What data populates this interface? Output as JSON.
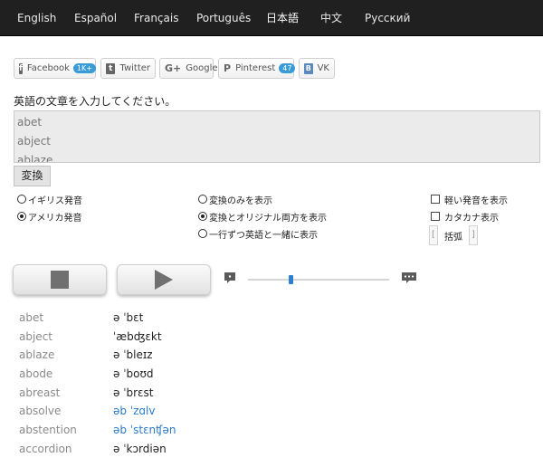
{
  "nav": {
    "languages": [
      {
        "label": "English",
        "active": false
      },
      {
        "label": "Español",
        "active": false
      },
      {
        "label": "Français",
        "active": false
      },
      {
        "label": "Português",
        "active": false
      },
      {
        "label": "日本語",
        "active": true
      },
      {
        "label": "中文",
        "active": false
      },
      {
        "label": "Русский",
        "active": false
      }
    ]
  },
  "share": {
    "facebook": {
      "label": "Facebook",
      "count": "1K+"
    },
    "twitter": {
      "label": "Twitter"
    },
    "google": {
      "label": "Google"
    },
    "pinterest": {
      "label": "Pinterest",
      "count": "47"
    },
    "vk": {
      "label": "VK"
    }
  },
  "input": {
    "prompt": "英語の文章を入力してください。",
    "lines": [
      "abet",
      "abject",
      "ablaze"
    ],
    "convert_label": "変換"
  },
  "options": {
    "british": {
      "label": "イギリス発音",
      "selected": false
    },
    "american": {
      "label": "アメリカ発音",
      "selected": true
    },
    "convert_only": {
      "label": "変換のみを表示",
      "selected": false
    },
    "convert_and_original": {
      "label": "変換とオリジナル両方を表示",
      "selected": true
    },
    "line_by_line": {
      "label": "一行ずつ英語と一緒に表示",
      "selected": false
    },
    "weak_forms": {
      "label": "軽い発音を表示",
      "checked": false
    },
    "katakana": {
      "label": "カタカナ表示",
      "checked": false
    },
    "brackets_label": "括弧",
    "bracket_left": "[",
    "bracket_right": "]"
  },
  "player": {
    "speed_fraction": 0.3
  },
  "results": [
    {
      "word": "abet",
      "ipa": "ə ˈbɛt",
      "highlight": false
    },
    {
      "word": "abject",
      "ipa": "ˈæbʤɛkt",
      "highlight": false
    },
    {
      "word": "ablaze",
      "ipa": "ə ˈbleɪz",
      "highlight": false
    },
    {
      "word": "abode",
      "ipa": "ə ˈboʊd",
      "highlight": false
    },
    {
      "word": "abreast",
      "ipa": "ə ˈbrɛst",
      "highlight": false
    },
    {
      "word": "absolve",
      "ipa": "əb ˈzɑlv",
      "highlight": true
    },
    {
      "word": "abstention",
      "ipa": "əb ˈstɛnʧən",
      "highlight": true
    },
    {
      "word": "accordion",
      "ipa": "ə ˈkɔrdiən",
      "highlight": false
    }
  ],
  "colors": {
    "nav_bg": "#202020",
    "accent": "#2a7ac9",
    "count_badge": "#3a9bd9"
  }
}
